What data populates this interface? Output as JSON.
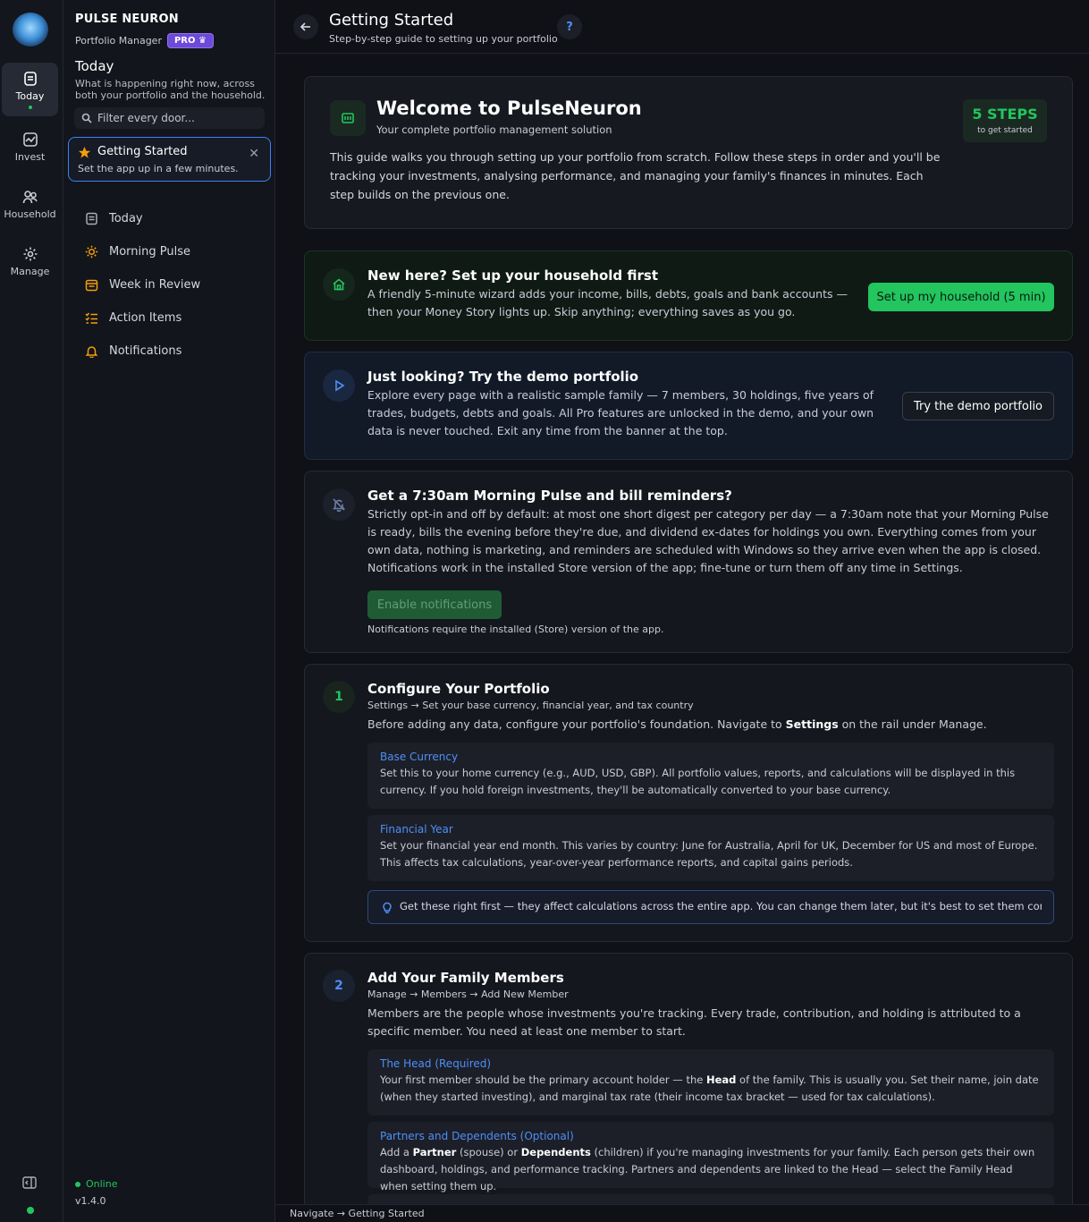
{
  "rail": {
    "items": [
      {
        "label": "Today",
        "icon": "today-icon"
      },
      {
        "label": "Invest",
        "icon": "chart-icon"
      },
      {
        "label": "Household",
        "icon": "people-icon"
      },
      {
        "label": "Manage",
        "icon": "gear-icon"
      }
    ]
  },
  "side": {
    "brand": "PULSE NEURON",
    "brand_sub": "Portfolio Manager",
    "pro": "PRO",
    "section_title": "Today",
    "section_desc": "What is happening right now, across both your portfolio and the household.",
    "filter_placeholder": "Filter every door...",
    "getting_started": {
      "title": "Getting Started",
      "subtitle": "Set the app up in a few minutes."
    },
    "nav": [
      {
        "label": "Today"
      },
      {
        "label": "Morning Pulse"
      },
      {
        "label": "Week in Review"
      },
      {
        "label": "Action Items"
      },
      {
        "label": "Notifications"
      }
    ],
    "status": "Online",
    "version": "v1.4.0"
  },
  "header": {
    "title": "Getting Started",
    "subtitle": "Step-by-step guide to setting up your portfolio",
    "help": "?"
  },
  "welcome": {
    "title": "Welcome to PulseNeuron",
    "subtitle": "Your complete portfolio management solution",
    "steps_badge": "5 STEPS",
    "steps_sub": "to get started",
    "body": "This guide walks you through setting up your portfolio from scratch. Follow these steps in order and you'll be tracking your investments, analysing performance, and managing your family's finances in minutes. Each step builds on the previous one."
  },
  "household_card": {
    "title": "New here? Set up your household first",
    "body": "A friendly 5-minute wizard adds your income, bills, debts, goals and bank accounts — then your Money Story lights up. Skip anything; everything saves as you go.",
    "button": "Set up my household (5 min)"
  },
  "demo_card": {
    "title": "Just looking? Try the demo portfolio",
    "body": "Explore every page with a realistic sample family — 7 members, 30 holdings, five years of trades, budgets, debts and goals. All Pro features are unlocked in the demo, and your own data is never touched. Exit any time from the banner at the top.",
    "button": "Try the demo portfolio"
  },
  "notify_card": {
    "title": "Get a 7:30am Morning Pulse and bill reminders?",
    "body": "Strictly opt-in and off by default: at most one short digest per category per day — a 7:30am note that your Morning Pulse is ready, bills the evening before they're due, and dividend ex-dates for holdings you own. Everything comes from your own data, nothing is marketing, and reminders are scheduled with Windows so they arrive even when the app is closed. Notifications work in the installed Store version of the app; fine-tune or turn them off any time in Settings.",
    "button": "Enable notifications",
    "note": "Notifications require the installed (Store) version of the app."
  },
  "step1": {
    "num": "1",
    "title": "Configure Your Portfolio",
    "path": "Settings  →  Set your base currency, financial year, and tax country",
    "intro_a": "Before adding any data, configure your portfolio's foundation. Navigate to ",
    "intro_b": "Settings",
    "intro_c": " on the rail under Manage.",
    "boxes": [
      {
        "title": "Base Currency",
        "text": "Set this to your home currency (e.g., AUD, USD, GBP). All portfolio values, reports, and calculations will be displayed in this currency. If you hold foreign investments, they'll be automatically converted to your base currency."
      },
      {
        "title": "Financial Year",
        "text": "Set your financial year end month. This varies by country: June for Australia, April for UK, December for US and most of Europe. This affects tax calculations, year-over-year performance reports, and capital gains periods."
      }
    ],
    "tip": "Get these right first — they affect calculations across the entire app. You can change them later, but it's best to set them correctly from th"
  },
  "step2": {
    "num": "2",
    "title": "Add Your Family Members",
    "path": "Manage  →  Members  →  Add New Member",
    "intro": "Members are the people whose investments you're tracking. Every trade, contribution, and holding is attributed to a specific member. You need at least one member to start.",
    "boxes": [
      {
        "title": "The Head (Required)",
        "a": "Your first member should be the primary account holder — the ",
        "b": "Head",
        "c": " of the family. This is usually you. Set their name, join date (when they started investing), and marginal tax rate (their income tax bracket — used for tax calculations)."
      },
      {
        "title": "Partners and Dependents (Optional)",
        "a": "Add a ",
        "b": "Partner",
        "c": " (spouse) or ",
        "d": "Dependents",
        "e": " (children) if you're managing investments for your family. Each person gets their own dashboard, holdings, and performance tracking. Partners and dependents are linked to the Head — select the Family Head when setting them up."
      }
    ]
  },
  "footer": "Navigate → Getting Started",
  "colors": {
    "accent": "#22c55e",
    "blue": "#4f8ef7",
    "background": "#0f1117"
  }
}
